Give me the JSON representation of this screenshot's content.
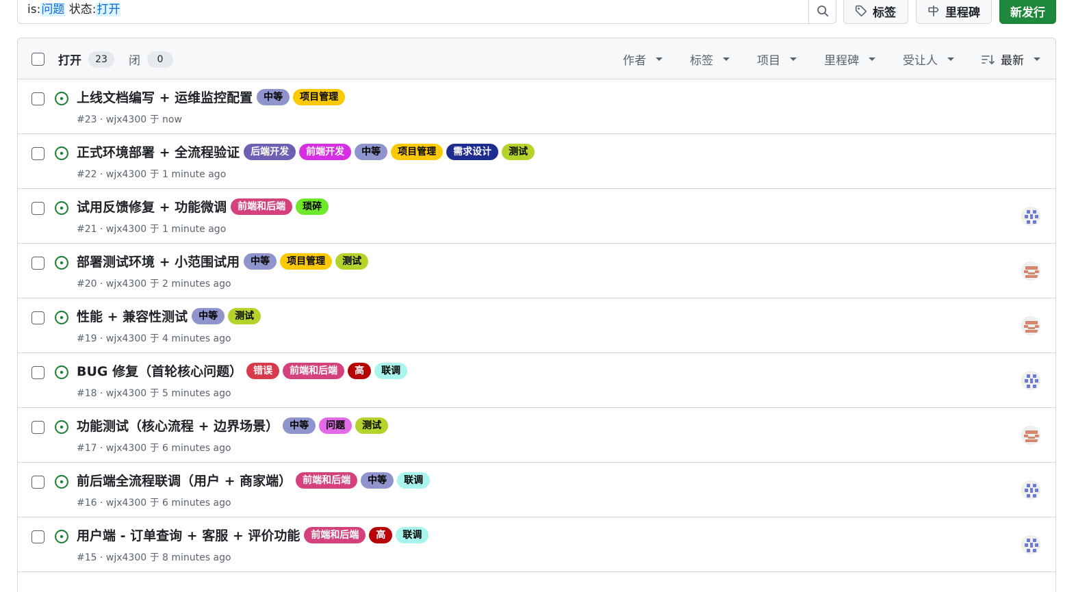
{
  "search": {
    "prefix1": "is:",
    "token1": "问题",
    "prefix2": " 状态:",
    "token2": "打开",
    "search_icon": "search-icon"
  },
  "toolbar": {
    "labels_label": "标签",
    "labels_icon": "tag-icon",
    "milestones_label": "里程碑",
    "milestones_icon": "milestone-icon",
    "new_issue_label": "新发行"
  },
  "header": {
    "open_label": "打开",
    "open_count": "23",
    "closed_label": "闭",
    "closed_count": "0",
    "filters": [
      "作者",
      "标签",
      "项目",
      "里程碑",
      "受让人"
    ],
    "sort_label": "最新",
    "sort_icon": "sort-desc-icon"
  },
  "colors": {
    "open_icon": "#1a7f37",
    "accent": "#0969da",
    "primary_button": "#1f883d"
  },
  "labels": {
    "中等": {
      "bg": "#8f95cc",
      "fg": "#000000"
    },
    "项目管理": {
      "bg": "#fbca04",
      "fg": "#000000"
    },
    "后端开发": {
      "bg": "#6f5fb3",
      "fg": "#ffffff"
    },
    "前端开发": {
      "bg": "#d62ee3",
      "fg": "#ffffff"
    },
    "需求设计": {
      "bg": "#1d2c8f",
      "fg": "#ffffff"
    },
    "测试": {
      "bg": "#b5d42b",
      "fg": "#000000"
    },
    "前端和后端": {
      "bg": "#d4417c",
      "fg": "#ffffff"
    },
    "琐碎": {
      "bg": "#6ee82a",
      "fg": "#000000"
    },
    "错误": {
      "bg": "#d73a4a",
      "fg": "#ffffff"
    },
    "高": {
      "bg": "#b60205",
      "fg": "#ffffff"
    },
    "联调": {
      "bg": "#a9f5ee",
      "fg": "#000000"
    },
    "问题": {
      "bg": "#e46be8",
      "fg": "#000000"
    }
  },
  "issues": [
    {
      "title": "上线文档编写 + 运维监控配置",
      "labels": [
        "中等",
        "项目管理"
      ],
      "meta": "#23 · wjx4300 于 now",
      "avatar": null
    },
    {
      "title": "正式环境部署 + 全流程验证",
      "labels": [
        "后端开发",
        "前端开发",
        "中等",
        "项目管理",
        "需求设计",
        "测试"
      ],
      "meta": "#22 · wjx4300 于 1 minute ago",
      "avatar": null
    },
    {
      "title": "试用反馈修复 + 功能微调",
      "labels": [
        "前端和后端",
        "琐碎"
      ],
      "meta": "#21 · wjx4300 于 1 minute ago",
      "avatar": "blue"
    },
    {
      "title": "部署测试环境 + 小范围试用",
      "labels": [
        "中等",
        "项目管理",
        "测试"
      ],
      "meta": "#20 · wjx4300 于 2 minutes ago",
      "avatar": "orange"
    },
    {
      "title": "性能 + 兼容性测试",
      "labels": [
        "中等",
        "测试"
      ],
      "meta": "#19 · wjx4300 于 4 minutes ago",
      "avatar": "orange"
    },
    {
      "title": "BUG 修复（首轮核心问题）",
      "labels": [
        "错误",
        "前端和后端",
        "高",
        "联调"
      ],
      "meta": "#18 · wjx4300 于 5 minutes ago",
      "avatar": "blue"
    },
    {
      "title": "功能测试（核心流程 + 边界场景）",
      "labels": [
        "中等",
        "问题",
        "测试"
      ],
      "meta": "#17 · wjx4300 于 6 minutes ago",
      "avatar": "orange"
    },
    {
      "title": "前后端全流程联调（用户 + 商家端）",
      "labels": [
        "前端和后端",
        "中等",
        "联调"
      ],
      "meta": "#16 · wjx4300 于 6 minutes ago",
      "avatar": "blue"
    },
    {
      "title": "用户端 - 订单查询 + 客服 + 评价功能",
      "labels": [
        "前端和后端",
        "高",
        "联调"
      ],
      "meta": "#15 · wjx4300 于 8 minutes ago",
      "avatar": "blue"
    }
  ]
}
